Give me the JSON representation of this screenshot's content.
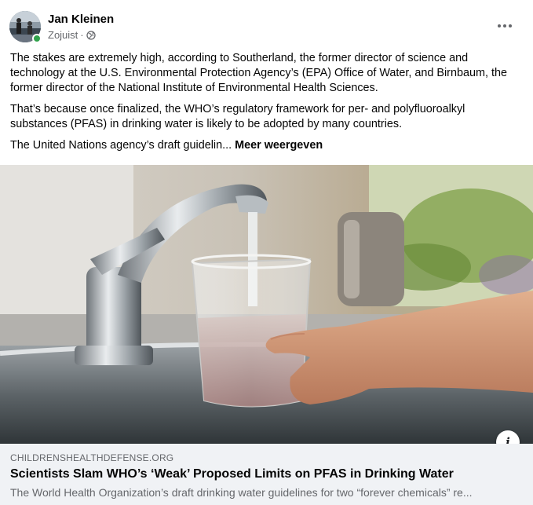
{
  "post": {
    "author": "Jan Kleinen",
    "time": "Zojuist",
    "separator": "·",
    "audience_icon": "globe-icon",
    "more_icon": "more-options-icon",
    "paragraphs": [
      "The stakes are extremely high, according to Southerland, the former director of science and technology at the U.S. Environmental Protection Agency’s (EPA) Office of Water, and Birnbaum, the former director of the National Institute of Environmental Health Sciences.",
      "That’s because once finalized, the WHO’s regulatory framework for per- and polyfluoroalkyl substances (PFAS) in drinking water is likely to be adopted by many countries."
    ],
    "truncated_text": "The United Nations agency’s draft guidelin...",
    "see_more": "Meer weergeven"
  },
  "link": {
    "domain": "CHILDRENSHEALTHDEFENSE.ORG",
    "title": "Scientists Slam WHO’s ‘Weak’ Proposed Limits on PFAS in Drinking Water",
    "description": "The World Health Organization’s draft drinking water guidelines for two “forever chemicals” re...",
    "info_icon": "info-icon",
    "info_label": "i"
  },
  "colors": {
    "online": "#31a24c",
    "secondary_text": "#65676b",
    "footer_bg": "#f0f2f5"
  }
}
